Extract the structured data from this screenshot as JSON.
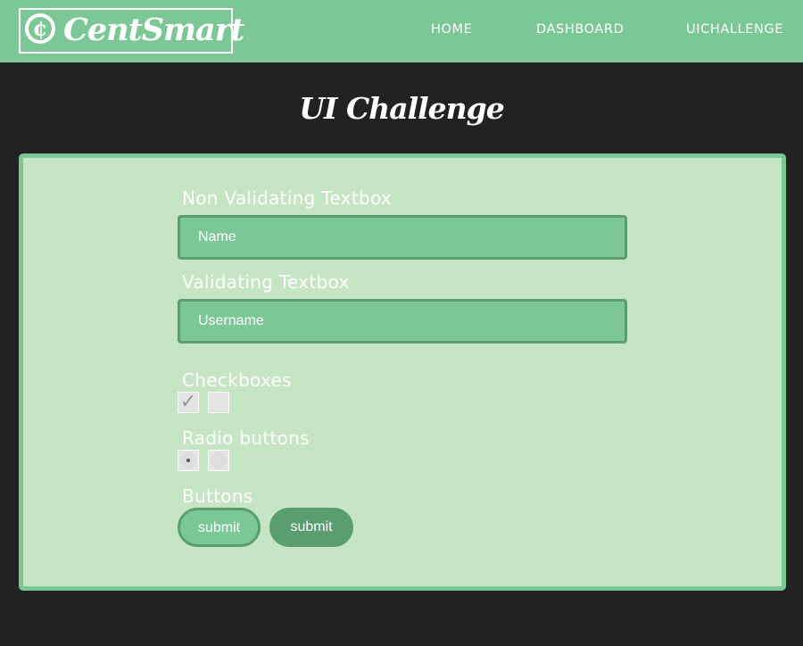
{
  "nav": {
    "logo_mark": "¢",
    "logo_text": "CentSmart",
    "links": [
      "HOME",
      "DASHBOARD",
      "UICHALLENGE"
    ]
  },
  "page": {
    "title": "UI Challenge"
  },
  "form": {
    "non_validating_label": "Non Validating Textbox",
    "name_placeholder": "Name",
    "validating_label": "Validating Textbox",
    "username_placeholder": "Username",
    "checkboxes_label": "Checkboxes",
    "checkboxes": [
      {
        "checked": true,
        "mark": "✓"
      },
      {
        "checked": false,
        "mark": ""
      }
    ],
    "radio_label": "Radio buttons",
    "radios": [
      {
        "selected": true
      },
      {
        "selected": false
      }
    ],
    "buttons_label": "Buttons",
    "buttons": [
      "submit",
      "submit"
    ]
  },
  "colors": {
    "navbar": "#7cc796",
    "background": "#222222",
    "panel": "#c6e5c4",
    "panel_border": "#7cc796",
    "input_bg": "#7cc796",
    "input_border": "#5a9e6f",
    "button_dark": "#5a9e6f",
    "text": "#ffffff"
  }
}
